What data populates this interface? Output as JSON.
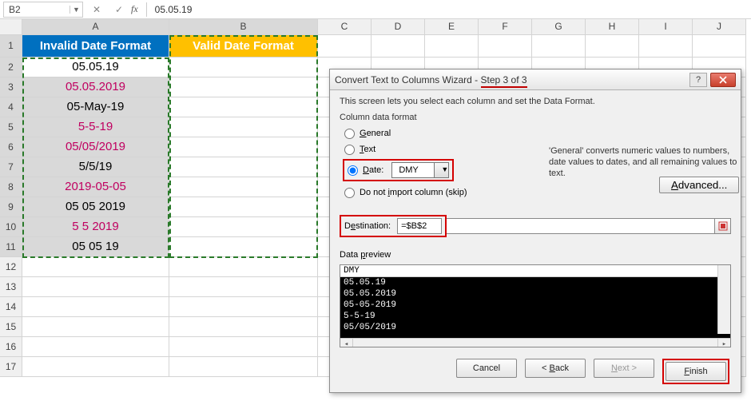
{
  "formula_bar": {
    "name_box": "B2",
    "fx_label": "fx",
    "formula": "05.05.19"
  },
  "columns": [
    "A",
    "B",
    "C",
    "D",
    "E",
    "F",
    "G",
    "H",
    "I",
    "J"
  ],
  "rows": [
    "1",
    "2",
    "3",
    "4",
    "5",
    "6",
    "7",
    "8",
    "9",
    "10",
    "11",
    "12",
    "13",
    "14",
    "15",
    "16",
    "17"
  ],
  "headers": {
    "a": "Invalid Date Format",
    "b": "Valid Date Format"
  },
  "data_rows": [
    {
      "val": "05.05.19",
      "pink": false
    },
    {
      "val": "05.05.2019",
      "pink": true
    },
    {
      "val": "05-May-19",
      "pink": false
    },
    {
      "val": "5-5-19",
      "pink": true
    },
    {
      "val": "05/05/2019",
      "pink": true
    },
    {
      "val": "5/5/19",
      "pink": false
    },
    {
      "val": "2019-05-05",
      "pink": true
    },
    {
      "val": "05 05 2019",
      "pink": false
    },
    {
      "val": "5 5 2019",
      "pink": true
    },
    {
      "val": "05 05 19",
      "pink": false
    }
  ],
  "dialog": {
    "title_prefix": "Convert Text to Columns Wizard - ",
    "title_step": "Step 3 of 3",
    "intro": "This screen lets you select each column and set the Data Format.",
    "fieldset": "Column data format",
    "opt_general": "General",
    "opt_text": "Text",
    "opt_date": "Date:",
    "date_format": "DMY",
    "opt_skip": "Do not import column (skip)",
    "side_note": "'General' converts numeric values to numbers, date values to dates, and all remaining values to text.",
    "advanced": "Advanced...",
    "dest_label": "Destination:",
    "dest_value": "=$B$2",
    "preview_label": "Data preview",
    "preview_head": "DMY",
    "preview_lines": [
      "05.05.19",
      "05.05.2019",
      "05-05-2019",
      "5-5-19",
      "05/05/2019"
    ],
    "btn_cancel": "Cancel",
    "btn_back": "< Back",
    "btn_next": "Next >",
    "btn_finish": "Finish"
  }
}
